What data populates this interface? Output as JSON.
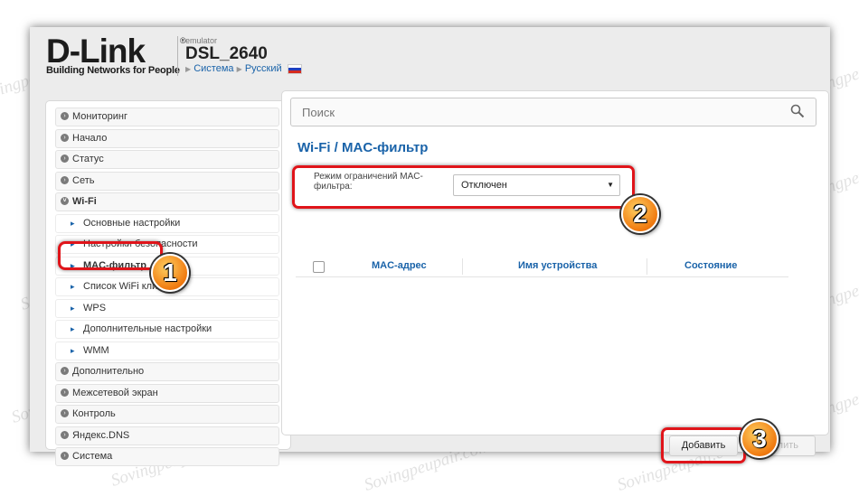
{
  "header": {
    "logo_text": "D-Link",
    "logo_registered": "®",
    "logo_tagline": "Building Networks for People",
    "emulator_label": "emulator",
    "model": "DSL_2640",
    "breadcrumb_system": "Система",
    "breadcrumb_language": "Русский"
  },
  "search": {
    "placeholder": "Поиск"
  },
  "sidebar": {
    "items": [
      {
        "label": "Мониторинг"
      },
      {
        "label": "Начало"
      },
      {
        "label": "Статус"
      },
      {
        "label": "Сеть"
      },
      {
        "label": "Wi-Fi"
      },
      {
        "label": "Основные настройки"
      },
      {
        "label": "Настройки безопасности"
      },
      {
        "label": "MAC-фильтр"
      },
      {
        "label": "Список WiFi клиентов"
      },
      {
        "label": "WPS"
      },
      {
        "label": "Дополнительные настройки"
      },
      {
        "label": "WMM"
      },
      {
        "label": "Дополнительно"
      },
      {
        "label": "Межсетевой экран"
      },
      {
        "label": "Контроль"
      },
      {
        "label": "Яндекс.DNS"
      },
      {
        "label": "Система"
      }
    ]
  },
  "main": {
    "breadcrumb_section": "Wi-Fi /",
    "page_title": "MAC-фильтр",
    "mode_label": "Режим ограничений MAC-фильтра:",
    "mode_value": "Отключен",
    "table_headers": [
      "MAC-адрес",
      "Имя устройства",
      "Состояние"
    ],
    "add_button": "Добавить",
    "delete_button": "Удалить"
  },
  "callouts": [
    "1",
    "2",
    "3"
  ],
  "watermark": "Sovingpeupair.com",
  "colors": {
    "accent": "#1a63a9",
    "highlight": "#e0141a",
    "callout": "#f07a10"
  }
}
